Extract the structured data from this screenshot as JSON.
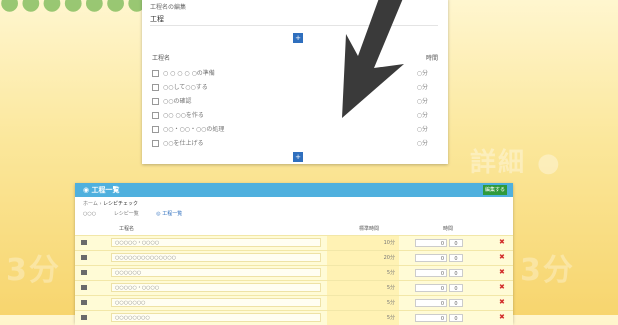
{
  "background": {
    "top_caption": "●●●●●●●",
    "mid_caption": "詳細 ●",
    "left_caption": "3分",
    "right_caption": "3分"
  },
  "dialog": {
    "title": "工程名の編集",
    "name_value": "工程",
    "add_top": "+",
    "col_process": "工程名",
    "col_time": "時間",
    "rows": [
      {
        "label": "○ ○ ○ ○ ○の準備",
        "value": "○分"
      },
      {
        "label": "○○して○○する",
        "value": "○分"
      },
      {
        "label": "○○の確認",
        "value": "○分"
      },
      {
        "label": "○○ ○○を作る",
        "value": "○分"
      },
      {
        "label": "○○・○○・○○の処理",
        "value": "○分"
      },
      {
        "label": "○○を仕上げる",
        "value": "○分"
      }
    ],
    "add_bottom": "+"
  },
  "panel": {
    "title": "◉ 工程一覧",
    "add_button": "編集する",
    "breadcrumb_home": "ホーム ›",
    "breadcrumb_current": "レシピチェック",
    "tabs": [
      "○○○",
      "レシピ一覧",
      "◎ 工程一覧"
    ],
    "columns": {
      "process": "工程名",
      "standard": "標準時間",
      "time": "時間"
    },
    "rows": [
      {
        "name": "○○○○○・○○○○",
        "time": "10分",
        "min": "0",
        "sec": "0"
      },
      {
        "name": "○○○○○○○○○○○○○○",
        "time": "20分",
        "min": "0",
        "sec": "0"
      },
      {
        "name": "○○○○○○",
        "time": "5分",
        "min": "0",
        "sec": "0"
      },
      {
        "name": "○○○○○・○○○○",
        "time": "5分",
        "min": "0",
        "sec": "0"
      },
      {
        "name": "○○○○○○○",
        "time": "5分",
        "min": "0",
        "sec": "0"
      },
      {
        "name": "○○○○○○○○",
        "time": "5分",
        "min": "0",
        "sec": "0"
      }
    ],
    "delete_glyph": "✖"
  },
  "colors": {
    "header": "#4fb0de",
    "add_button": "#2f9a3c",
    "plus_button": "#2f6fbe",
    "delete": "#d12a2a"
  },
  "icons": {
    "arrow": "arrow-down-left-icon",
    "edit": "edit-icon",
    "delete": "delete-icon"
  }
}
